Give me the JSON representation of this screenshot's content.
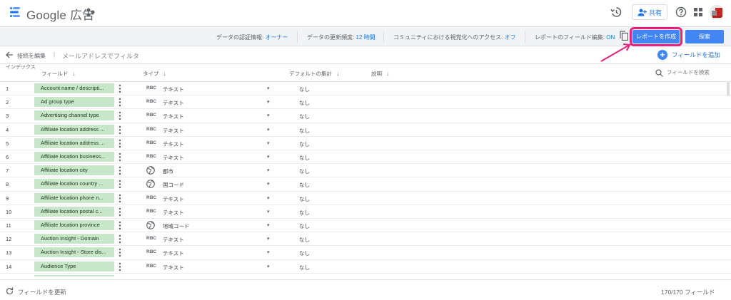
{
  "app": {
    "title": "Google 広告",
    "share_label": "共有"
  },
  "infobar": {
    "credentials_label": "データの認証情報: ",
    "credentials_value": "オーナー",
    "freshness_label": "データの更新頻度: ",
    "freshness_value": "12 時間",
    "community_label": "コミュニティにおける視覚化へのアクセス: ",
    "community_value": "オフ",
    "field_edit_label": "レポートのフィールド編集: ",
    "field_edit_value": "ON",
    "create_report_label": "レポートを作成",
    "explore_label": "探索"
  },
  "breadcrumb": {
    "edit_connection": "接続を編集",
    "separator": "|",
    "filter_placeholder": "メールアドレスでフィルタ",
    "add_field": "フィールドを追加"
  },
  "table": {
    "headers": {
      "index": "インデックス",
      "field": "フィールド",
      "type": "タイプ",
      "aggregation": "デフォルトの集計",
      "description": "説明"
    },
    "search_placeholder": "フィールドを検索",
    "rows": [
      {
        "index": "1",
        "field": "Account name / descripti...",
        "type_icon": "abc-icon",
        "type": "テキスト",
        "aggregation": "なし"
      },
      {
        "index": "2",
        "field": "Ad group type",
        "type_icon": "abc-icon",
        "type": "テキスト",
        "aggregation": "なし"
      },
      {
        "index": "3",
        "field": "Advertising channel type",
        "type_icon": "abc-icon",
        "type": "テキスト",
        "aggregation": "なし"
      },
      {
        "index": "4",
        "field": "Affiliate location address ...",
        "type_icon": "abc-icon",
        "type": "テキスト",
        "aggregation": "なし"
      },
      {
        "index": "5",
        "field": "Affiliate location address ...",
        "type_icon": "abc-icon",
        "type": "テキスト",
        "aggregation": "なし"
      },
      {
        "index": "6",
        "field": "Affiliate location business...",
        "type_icon": "abc-icon",
        "type": "テキスト",
        "aggregation": "なし"
      },
      {
        "index": "7",
        "field": "Affiliate location city",
        "type_icon": "globe-icon",
        "type": "都市",
        "aggregation": "なし"
      },
      {
        "index": "8",
        "field": "Affiliate location country ...",
        "type_icon": "globe-icon",
        "type": "国コード",
        "aggregation": "なし"
      },
      {
        "index": "9",
        "field": "Affiliate location phone n...",
        "type_icon": "abc-icon",
        "type": "テキスト",
        "aggregation": "なし"
      },
      {
        "index": "10",
        "field": "Affiliate location postal c...",
        "type_icon": "abc-icon",
        "type": "テキスト",
        "aggregation": "なし"
      },
      {
        "index": "11",
        "field": "Affiliate location province",
        "type_icon": "globe-icon",
        "type": "地域コード",
        "aggregation": "なし"
      },
      {
        "index": "12",
        "field": "Auction Insight - Domain",
        "type_icon": "abc-icon",
        "type": "テキスト",
        "aggregation": "なし"
      },
      {
        "index": "13",
        "field": "Auction Insight - Store dis...",
        "type_icon": "abc-icon",
        "type": "テキスト",
        "aggregation": "なし"
      },
      {
        "index": "14",
        "field": "Audience Type",
        "type_icon": "abc-icon",
        "type": "テキスト",
        "aggregation": "なし"
      },
      {
        "index": "",
        "field": "",
        "type_icon": "abc-icon",
        "type": "",
        "aggregation": ""
      }
    ]
  },
  "footer": {
    "refresh_label": "フィールドを更新",
    "count_label": "170/170 フィールド"
  },
  "colors": {
    "accent": "#4285f4",
    "pill": "#c8e6c9",
    "highlight": "#e8207e"
  }
}
